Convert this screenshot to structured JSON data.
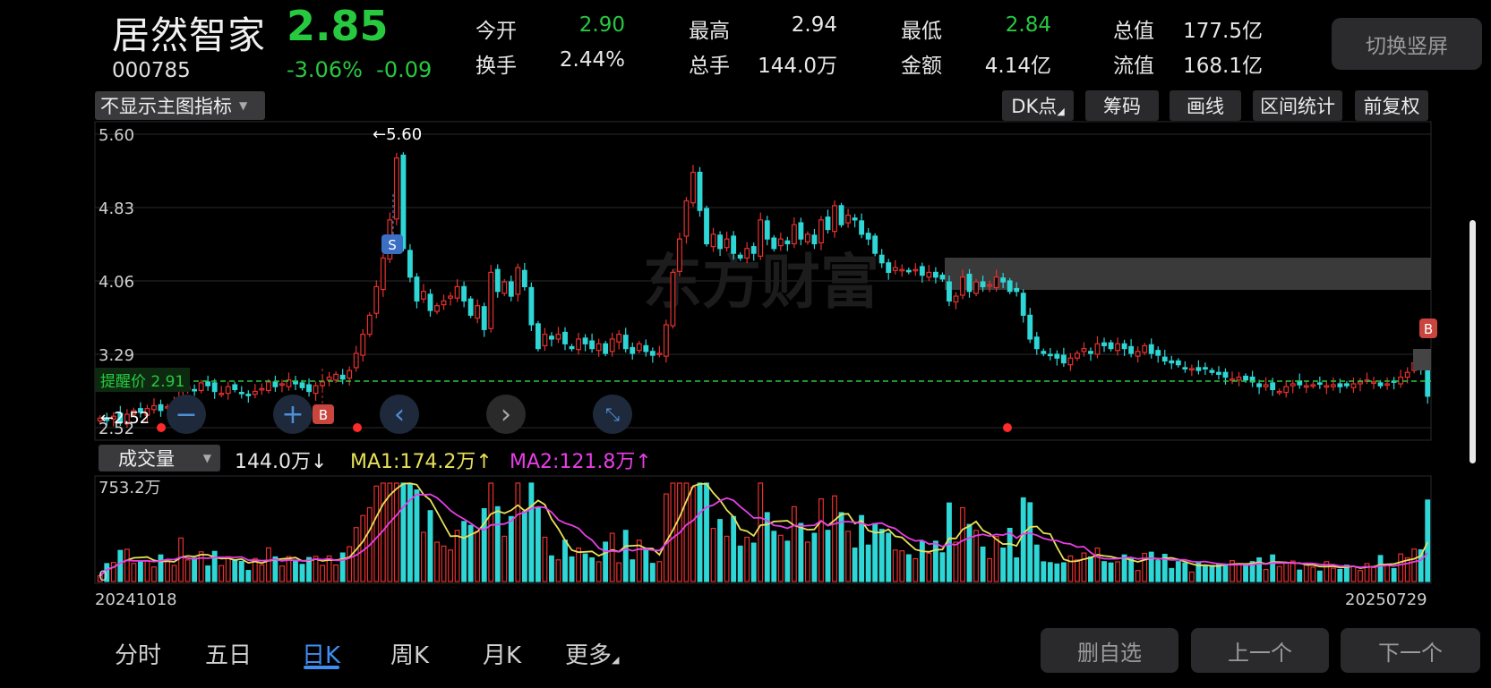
{
  "stock": {
    "name": "居然智家",
    "code": "000785",
    "price": "2.85",
    "change_pct": "-3.06%",
    "change_abs": "-0.09"
  },
  "quote": {
    "open_label": "今开",
    "open": "2.90",
    "turnover_label": "换手",
    "turnover": "2.44%",
    "high_label": "最高",
    "high": "2.94",
    "total_vol_label": "总手",
    "total_vol": "144.0万",
    "low_label": "最低",
    "low": "2.84",
    "amount_label": "金额",
    "amount": "4.14亿",
    "mktcap_label": "总值",
    "mktcap": "177.5亿",
    "float_label": "流值",
    "float_cap": "168.1亿"
  },
  "switch_label": "切换竖屏",
  "toolbar": {
    "indicator_select": "不显示主图指标",
    "dk": "DK点",
    "chips": "筹码",
    "draw": "画线",
    "range_stats": "区间统计",
    "adjust": "前复权"
  },
  "price_axis": [
    "5.60",
    "4.83",
    "4.06",
    "3.29",
    "2.52"
  ],
  "annotations": {
    "high_marker": "←5.60",
    "low_marker": "←2.52",
    "alert": "提醒价 2.91",
    "buy": "B",
    "sell": "S"
  },
  "watermark": "东方财富",
  "volume": {
    "select": "成交量",
    "current": "144.0万↓",
    "ma1": "MA1:174.2万↑",
    "ma2": "MA2:121.8万↑",
    "max_label": "753.2万",
    "zero_label": "0"
  },
  "dates": {
    "start": "20241018",
    "end": "20250729"
  },
  "tabs": [
    "分时",
    "五日",
    "日K",
    "周K",
    "月K",
    "更多"
  ],
  "active_tab": "日K",
  "buttons": {
    "remove_watch": "删自选",
    "prev": "上一个",
    "next": "下一个"
  },
  "colors": {
    "up": "#e5312f",
    "down": "#2fd6d6",
    "ma1": "#e8e05a",
    "ma2": "#e63fe6",
    "accent": "#3f8ef0",
    "alert_line": "#27c93f"
  },
  "chart_data": {
    "type": "candlestick",
    "title": "",
    "x_range": [
      "20241018",
      "20250729"
    ],
    "ylim": [
      2.52,
      5.6
    ],
    "y_ticks": [
      5.6,
      4.83,
      4.06,
      3.29,
      2.52
    ],
    "alert_price": 2.91,
    "close": [
      2.62,
      2.6,
      2.64,
      2.58,
      2.66,
      2.7,
      2.68,
      2.72,
      2.75,
      2.7,
      2.74,
      2.78,
      2.9,
      2.95,
      2.92,
      2.99,
      2.96,
      2.9,
      2.88,
      2.95,
      2.92,
      2.88,
      2.86,
      2.9,
      2.93,
      3.0,
      2.95,
      2.98,
      3.02,
      2.98,
      2.94,
      2.9,
      2.96,
      3.0,
      3.05,
      3.08,
      3.03,
      3.12,
      3.3,
      3.5,
      3.7,
      4.0,
      4.3,
      4.7,
      5.35,
      4.4,
      4.1,
      3.85,
      3.95,
      3.75,
      3.8,
      3.85,
      3.9,
      4.0,
      3.85,
      3.7,
      3.8,
      3.55,
      4.15,
      3.95,
      4.05,
      3.9,
      4.2,
      4.0,
      3.6,
      3.35,
      3.5,
      3.45,
      3.5,
      3.4,
      3.35,
      3.45,
      3.4,
      3.35,
      3.4,
      3.3,
      3.45,
      3.5,
      3.35,
      3.3,
      3.4,
      3.32,
      3.28,
      3.3,
      3.6,
      4.15,
      4.5,
      4.9,
      5.2,
      4.8,
      4.45,
      4.55,
      4.4,
      4.5,
      4.35,
      4.3,
      4.4,
      4.35,
      4.7,
      4.5,
      4.4,
      4.5,
      4.45,
      4.65,
      4.5,
      4.55,
      4.45,
      4.7,
      4.6,
      4.85,
      4.65,
      4.75,
      4.7,
      4.55,
      4.5,
      4.35,
      4.25,
      4.15,
      4.2,
      4.18,
      4.16,
      4.18,
      4.12,
      4.15,
      4.1,
      4.08,
      3.85,
      3.9,
      4.1,
      3.95,
      4.05,
      4.0,
      4.02,
      4.1,
      4.05,
      3.95,
      3.95,
      3.7,
      3.45,
      3.35,
      3.3,
      3.28,
      3.25,
      3.2,
      3.25,
      3.3,
      3.35,
      3.3,
      3.4,
      3.38,
      3.35,
      3.4,
      3.35,
      3.3,
      3.32,
      3.38,
      3.3,
      3.28,
      3.22,
      3.2,
      3.18,
      3.15,
      3.14,
      3.12,
      3.14,
      3.1,
      3.08,
      3.05,
      3.03,
      3.05,
      3.02,
      3.0,
      2.95,
      2.97,
      2.92,
      2.9,
      2.95,
      2.98,
      2.97,
      2.96,
      2.97,
      2.98,
      2.96,
      2.97,
      2.95,
      2.96,
      2.98,
      3.0,
      3.02,
      3.0,
      2.96,
      2.98,
      3.0,
      3.05,
      3.1,
      3.2,
      3.13,
      2.85
    ]
  }
}
